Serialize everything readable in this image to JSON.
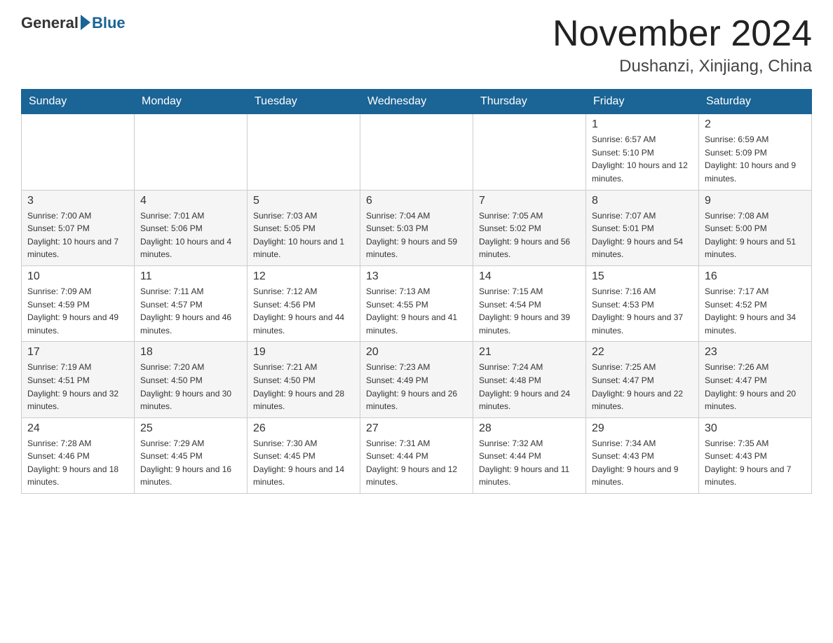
{
  "header": {
    "logo_general": "General",
    "logo_blue": "Blue",
    "month_title": "November 2024",
    "location": "Dushanzi, Xinjiang, China"
  },
  "weekdays": [
    "Sunday",
    "Monday",
    "Tuesday",
    "Wednesday",
    "Thursday",
    "Friday",
    "Saturday"
  ],
  "weeks": [
    [
      {
        "day": "",
        "info": ""
      },
      {
        "day": "",
        "info": ""
      },
      {
        "day": "",
        "info": ""
      },
      {
        "day": "",
        "info": ""
      },
      {
        "day": "",
        "info": ""
      },
      {
        "day": "1",
        "info": "Sunrise: 6:57 AM\nSunset: 5:10 PM\nDaylight: 10 hours and 12 minutes."
      },
      {
        "day": "2",
        "info": "Sunrise: 6:59 AM\nSunset: 5:09 PM\nDaylight: 10 hours and 9 minutes."
      }
    ],
    [
      {
        "day": "3",
        "info": "Sunrise: 7:00 AM\nSunset: 5:07 PM\nDaylight: 10 hours and 7 minutes."
      },
      {
        "day": "4",
        "info": "Sunrise: 7:01 AM\nSunset: 5:06 PM\nDaylight: 10 hours and 4 minutes."
      },
      {
        "day": "5",
        "info": "Sunrise: 7:03 AM\nSunset: 5:05 PM\nDaylight: 10 hours and 1 minute."
      },
      {
        "day": "6",
        "info": "Sunrise: 7:04 AM\nSunset: 5:03 PM\nDaylight: 9 hours and 59 minutes."
      },
      {
        "day": "7",
        "info": "Sunrise: 7:05 AM\nSunset: 5:02 PM\nDaylight: 9 hours and 56 minutes."
      },
      {
        "day": "8",
        "info": "Sunrise: 7:07 AM\nSunset: 5:01 PM\nDaylight: 9 hours and 54 minutes."
      },
      {
        "day": "9",
        "info": "Sunrise: 7:08 AM\nSunset: 5:00 PM\nDaylight: 9 hours and 51 minutes."
      }
    ],
    [
      {
        "day": "10",
        "info": "Sunrise: 7:09 AM\nSunset: 4:59 PM\nDaylight: 9 hours and 49 minutes."
      },
      {
        "day": "11",
        "info": "Sunrise: 7:11 AM\nSunset: 4:57 PM\nDaylight: 9 hours and 46 minutes."
      },
      {
        "day": "12",
        "info": "Sunrise: 7:12 AM\nSunset: 4:56 PM\nDaylight: 9 hours and 44 minutes."
      },
      {
        "day": "13",
        "info": "Sunrise: 7:13 AM\nSunset: 4:55 PM\nDaylight: 9 hours and 41 minutes."
      },
      {
        "day": "14",
        "info": "Sunrise: 7:15 AM\nSunset: 4:54 PM\nDaylight: 9 hours and 39 minutes."
      },
      {
        "day": "15",
        "info": "Sunrise: 7:16 AM\nSunset: 4:53 PM\nDaylight: 9 hours and 37 minutes."
      },
      {
        "day": "16",
        "info": "Sunrise: 7:17 AM\nSunset: 4:52 PM\nDaylight: 9 hours and 34 minutes."
      }
    ],
    [
      {
        "day": "17",
        "info": "Sunrise: 7:19 AM\nSunset: 4:51 PM\nDaylight: 9 hours and 32 minutes."
      },
      {
        "day": "18",
        "info": "Sunrise: 7:20 AM\nSunset: 4:50 PM\nDaylight: 9 hours and 30 minutes."
      },
      {
        "day": "19",
        "info": "Sunrise: 7:21 AM\nSunset: 4:50 PM\nDaylight: 9 hours and 28 minutes."
      },
      {
        "day": "20",
        "info": "Sunrise: 7:23 AM\nSunset: 4:49 PM\nDaylight: 9 hours and 26 minutes."
      },
      {
        "day": "21",
        "info": "Sunrise: 7:24 AM\nSunset: 4:48 PM\nDaylight: 9 hours and 24 minutes."
      },
      {
        "day": "22",
        "info": "Sunrise: 7:25 AM\nSunset: 4:47 PM\nDaylight: 9 hours and 22 minutes."
      },
      {
        "day": "23",
        "info": "Sunrise: 7:26 AM\nSunset: 4:47 PM\nDaylight: 9 hours and 20 minutes."
      }
    ],
    [
      {
        "day": "24",
        "info": "Sunrise: 7:28 AM\nSunset: 4:46 PM\nDaylight: 9 hours and 18 minutes."
      },
      {
        "day": "25",
        "info": "Sunrise: 7:29 AM\nSunset: 4:45 PM\nDaylight: 9 hours and 16 minutes."
      },
      {
        "day": "26",
        "info": "Sunrise: 7:30 AM\nSunset: 4:45 PM\nDaylight: 9 hours and 14 minutes."
      },
      {
        "day": "27",
        "info": "Sunrise: 7:31 AM\nSunset: 4:44 PM\nDaylight: 9 hours and 12 minutes."
      },
      {
        "day": "28",
        "info": "Sunrise: 7:32 AM\nSunset: 4:44 PM\nDaylight: 9 hours and 11 minutes."
      },
      {
        "day": "29",
        "info": "Sunrise: 7:34 AM\nSunset: 4:43 PM\nDaylight: 9 hours and 9 minutes."
      },
      {
        "day": "30",
        "info": "Sunrise: 7:35 AM\nSunset: 4:43 PM\nDaylight: 9 hours and 7 minutes."
      }
    ]
  ]
}
